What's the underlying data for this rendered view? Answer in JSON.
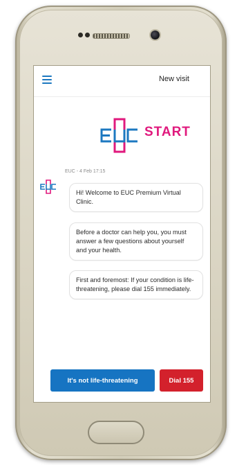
{
  "header": {
    "title": "New visit",
    "menu_icon": "hamburger-menu-icon"
  },
  "brand": {
    "logo_text": "EUC START",
    "logo_word": "START",
    "colors": {
      "magenta": "#e0197d",
      "blue": "#1c78c0"
    }
  },
  "chat": {
    "meta": "EUC - 4 Feb 17:15",
    "messages": [
      {
        "text": "Hi! Welcome to EUC Premium Virtual Clinic."
      },
      {
        "text": "Before a doctor can help you, you must answer a few questions about yourself and your health."
      },
      {
        "text": "First and foremost: If your condition is life-threatening, please dial 155 immediately."
      }
    ]
  },
  "actions": {
    "not_life_threatening": "It's not life-threatening",
    "dial": "Dial 155",
    "colors": {
      "primary": "#1674c2",
      "danger": "#d3212c"
    }
  }
}
